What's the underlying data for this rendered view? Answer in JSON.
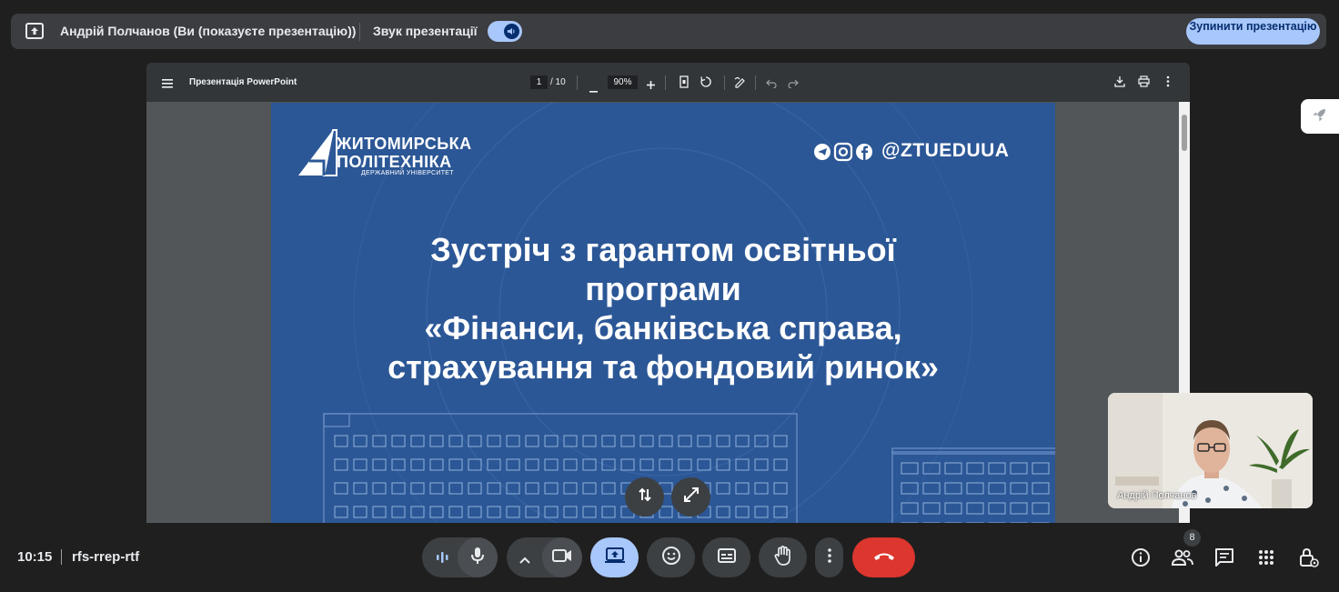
{
  "topbar": {
    "presenter_text": "Андрій Полчанов (Ви (показуєте презентацію))",
    "sound_label": "Звук презентації",
    "stop_button": "Зупинити презентацію"
  },
  "pdf": {
    "title": "Презентація PowerPoint",
    "page_current": "1",
    "page_total": "/ 10",
    "zoom": "90%"
  },
  "slide": {
    "logo_line1": "ЖИТОМИРСЬКА",
    "logo_line2": "ПОЛІТЕХНІКА",
    "logo_line3": "ДЕРЖАВНИЙ УНІВЕРСИТЕТ",
    "handle": "@ZTUEDUUA",
    "title_lines": [
      "Зустріч з гарантом освітньої",
      "програми",
      "«Фінанси, банківська справа,",
      "страхування та фондовий ринок»"
    ]
  },
  "self_view": {
    "name": "Андрій Полчанов"
  },
  "bottombar": {
    "time": "10:15",
    "meeting_code": "rfs-rrep-rtf",
    "people_count": "8"
  },
  "colors": {
    "accent": "#a8c7fa",
    "end_call": "#dc362e",
    "slide_bg": "#2c5796"
  }
}
